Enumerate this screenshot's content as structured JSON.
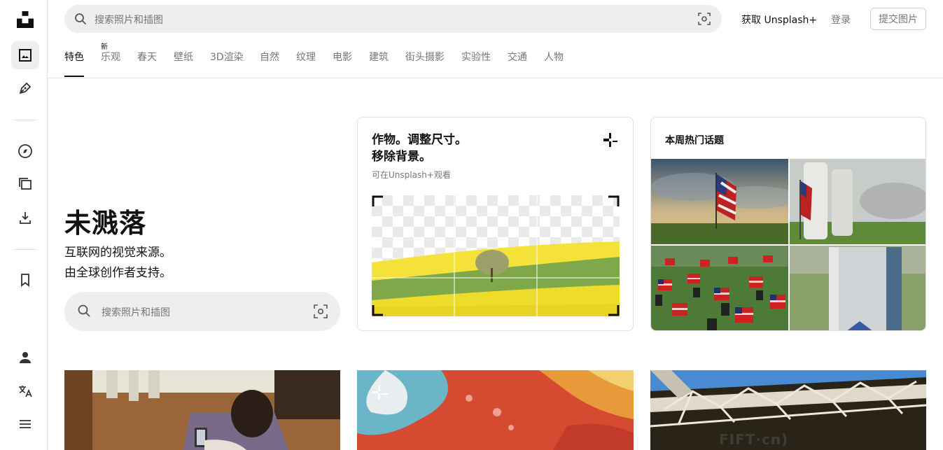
{
  "header": {
    "search_placeholder": "搜索照片和插图",
    "get_plus": "获取 Unsplash+",
    "login": "登录",
    "submit": "提交图片"
  },
  "sidebar": {
    "items": [
      "logo-icon",
      "image-icon",
      "pen-icon",
      "compass-icon",
      "collections-icon",
      "download-icon",
      "bookmark-icon",
      "person-icon",
      "translate-icon",
      "menu-icon"
    ]
  },
  "tabs": {
    "new_badge": "新",
    "items": [
      "特色",
      "乐观",
      "春天",
      "壁纸",
      "3D渲染",
      "自然",
      "纹理",
      "电影",
      "建筑",
      "街头摄影",
      "实验性",
      "交通",
      "人物"
    ],
    "active": "特色"
  },
  "hero": {
    "title": "未溅落",
    "sub1": "互联网的视觉来源。",
    "sub2": "由全球创作者支持。",
    "search_placeholder": "搜索照片和插图"
  },
  "promo": {
    "title1": "作物。调整尺寸。",
    "title2": "移除背景。",
    "sub": "可在Unsplash+观看"
  },
  "topics": {
    "title": "本周热门话题"
  },
  "watermark": "FIFT·cn)",
  "colors": {
    "accent": "#111111",
    "muted": "#767676",
    "search_bg": "#eeeeee"
  }
}
